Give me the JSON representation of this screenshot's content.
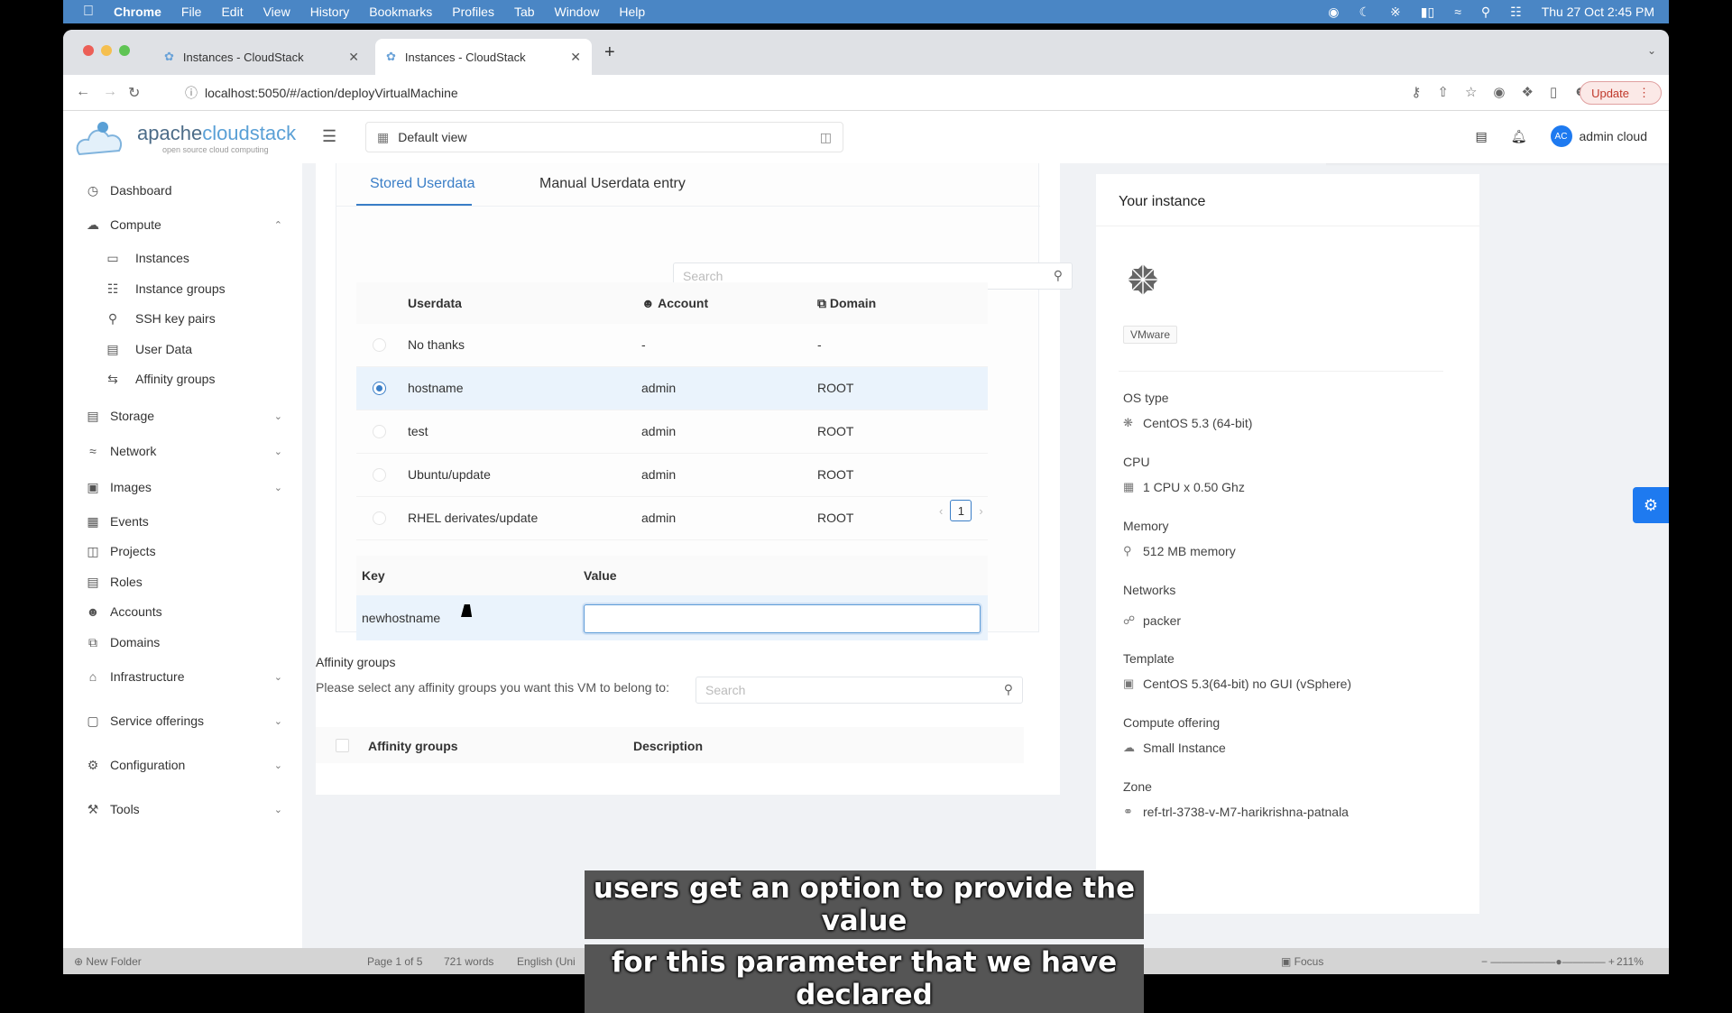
{
  "menubar": {
    "app": "Chrome",
    "items": [
      "File",
      "Edit",
      "View",
      "History",
      "Bookmarks",
      "Profiles",
      "Tab",
      "Window",
      "Help"
    ],
    "datetime": "Thu 27 Oct  2:45 PM"
  },
  "browser": {
    "tabs": [
      {
        "title": "Instances - CloudStack",
        "active": false
      },
      {
        "title": "Instances - CloudStack",
        "active": true
      }
    ],
    "url": "localhost:5050/#/action/deployVirtualMachine",
    "update_label": "Update"
  },
  "header": {
    "logo_name_a": "apache",
    "logo_name_b": "cloudstack",
    "logo_tagline": "open source cloud computing",
    "view_selector": "Default view",
    "user": "admin cloud",
    "avatar_initials": "AC"
  },
  "sidebar": {
    "items": [
      {
        "label": "Dashboard",
        "icon": "dashboard-icon"
      },
      {
        "label": "Compute",
        "icon": "cloud-icon",
        "expanded": true
      },
      {
        "label": "Instances",
        "icon": "desktop-icon",
        "sub": true
      },
      {
        "label": "Instance groups",
        "icon": "cluster-icon",
        "sub": true
      },
      {
        "label": "SSH key pairs",
        "icon": "key-icon",
        "sub": true
      },
      {
        "label": "User Data",
        "icon": "document-icon",
        "sub": true
      },
      {
        "label": "Affinity groups",
        "icon": "swap-icon",
        "sub": true
      },
      {
        "label": "Storage",
        "icon": "database-icon"
      },
      {
        "label": "Network",
        "icon": "wifi-icon"
      },
      {
        "label": "Images",
        "icon": "picture-icon"
      },
      {
        "label": "Events",
        "icon": "calendar-icon"
      },
      {
        "label": "Projects",
        "icon": "project-icon"
      },
      {
        "label": "Roles",
        "icon": "idcard-icon"
      },
      {
        "label": "Accounts",
        "icon": "team-icon"
      },
      {
        "label": "Domains",
        "icon": "block-icon"
      },
      {
        "label": "Infrastructure",
        "icon": "bank-icon"
      },
      {
        "label": "Service offerings",
        "icon": "shopping-icon"
      },
      {
        "label": "Configuration",
        "icon": "setting-icon"
      },
      {
        "label": "Tools",
        "icon": "tool-icon"
      }
    ]
  },
  "userdata": {
    "tabs": [
      "Stored Userdata",
      "Manual Userdata entry"
    ],
    "active_tab": 0,
    "search_placeholder": "Search",
    "columns": [
      "Userdata",
      "Account",
      "Domain"
    ],
    "rows": [
      {
        "name": "No thanks",
        "account": "-",
        "domain": "-",
        "selected": false
      },
      {
        "name": "hostname",
        "account": "admin",
        "domain": "ROOT",
        "selected": true
      },
      {
        "name": "test",
        "account": "admin",
        "domain": "ROOT",
        "selected": false
      },
      {
        "name": "Ubuntu/update",
        "account": "admin",
        "domain": "ROOT",
        "selected": false
      },
      {
        "name": "RHEL derivates/update",
        "account": "admin",
        "domain": "ROOT",
        "selected": false
      }
    ],
    "page": "1",
    "kv_columns": [
      "Key",
      "Value"
    ],
    "kv_rows": [
      {
        "key": "newhostname",
        "value": ""
      }
    ]
  },
  "affinity": {
    "title": "Affinity groups",
    "description": "Please select any affinity groups you want this VM to belong to:",
    "search_placeholder": "Search",
    "columns": [
      "Affinity groups",
      "Description"
    ]
  },
  "instance": {
    "title": "Your instance",
    "hypervisor": "VMware",
    "props": [
      {
        "label": "OS type",
        "value": "CentOS 5.3 (64-bit)",
        "icon": "centos-icon"
      },
      {
        "label": "CPU",
        "value": "1 CPU x 0.50 Ghz",
        "icon": "appstore-icon"
      },
      {
        "label": "Memory",
        "value": "512 MB memory",
        "icon": "bulb-icon"
      },
      {
        "label": "Networks",
        "value": "packer",
        "icon": "api-icon"
      },
      {
        "label": "Template",
        "value": "CentOS 5.3(64-bit) no GUI (vSphere)",
        "icon": "picture-icon"
      },
      {
        "label": "Compute offering",
        "value": "Small Instance",
        "icon": "cloud-icon"
      },
      {
        "label": "Zone",
        "value": "ref-trl-3738-v-M7-harikrishna-patnala",
        "icon": "global-icon"
      }
    ]
  },
  "statusbar": {
    "new_folder": "New Folder",
    "page": "Page 1 of 5",
    "words": "721 words",
    "language": "English (Uni",
    "focus": "Focus",
    "zoom": "211%"
  },
  "caption": {
    "line1": "users get an option to provide the value",
    "line2": "for this parameter that we have declared"
  }
}
